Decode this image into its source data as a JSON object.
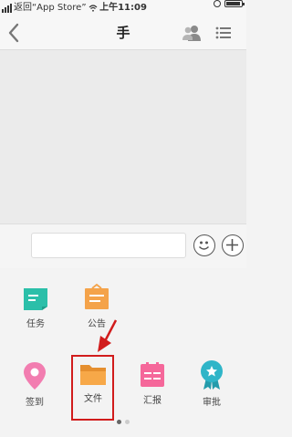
{
  "status_bar": {
    "back_to_app": "返回“App Store”",
    "time": "上午11:09"
  },
  "nav": {
    "title": "手"
  },
  "composer": {
    "placeholder": ""
  },
  "apps": [
    {
      "label": "任务",
      "icon": "task-icon",
      "color": "#2bbfa9"
    },
    {
      "label": "公告",
      "icon": "announcement-icon",
      "color": "#f4a34a"
    },
    {
      "label": "签到",
      "icon": "location-pin-icon",
      "color": "#f27db0"
    },
    {
      "label": "文件",
      "icon": "folder-icon",
      "color": "#f7a848"
    },
    {
      "label": "汇报",
      "icon": "report-icon",
      "color": "#f5679a"
    },
    {
      "label": "审批",
      "icon": "approval-badge-icon",
      "color": "#2fb5c8"
    }
  ],
  "colors": {
    "highlight": "#d11c1c",
    "dot_active": "#666666",
    "dot_inactive": "#cccccc"
  },
  "pagination": {
    "pages": 2,
    "current": 1
  }
}
